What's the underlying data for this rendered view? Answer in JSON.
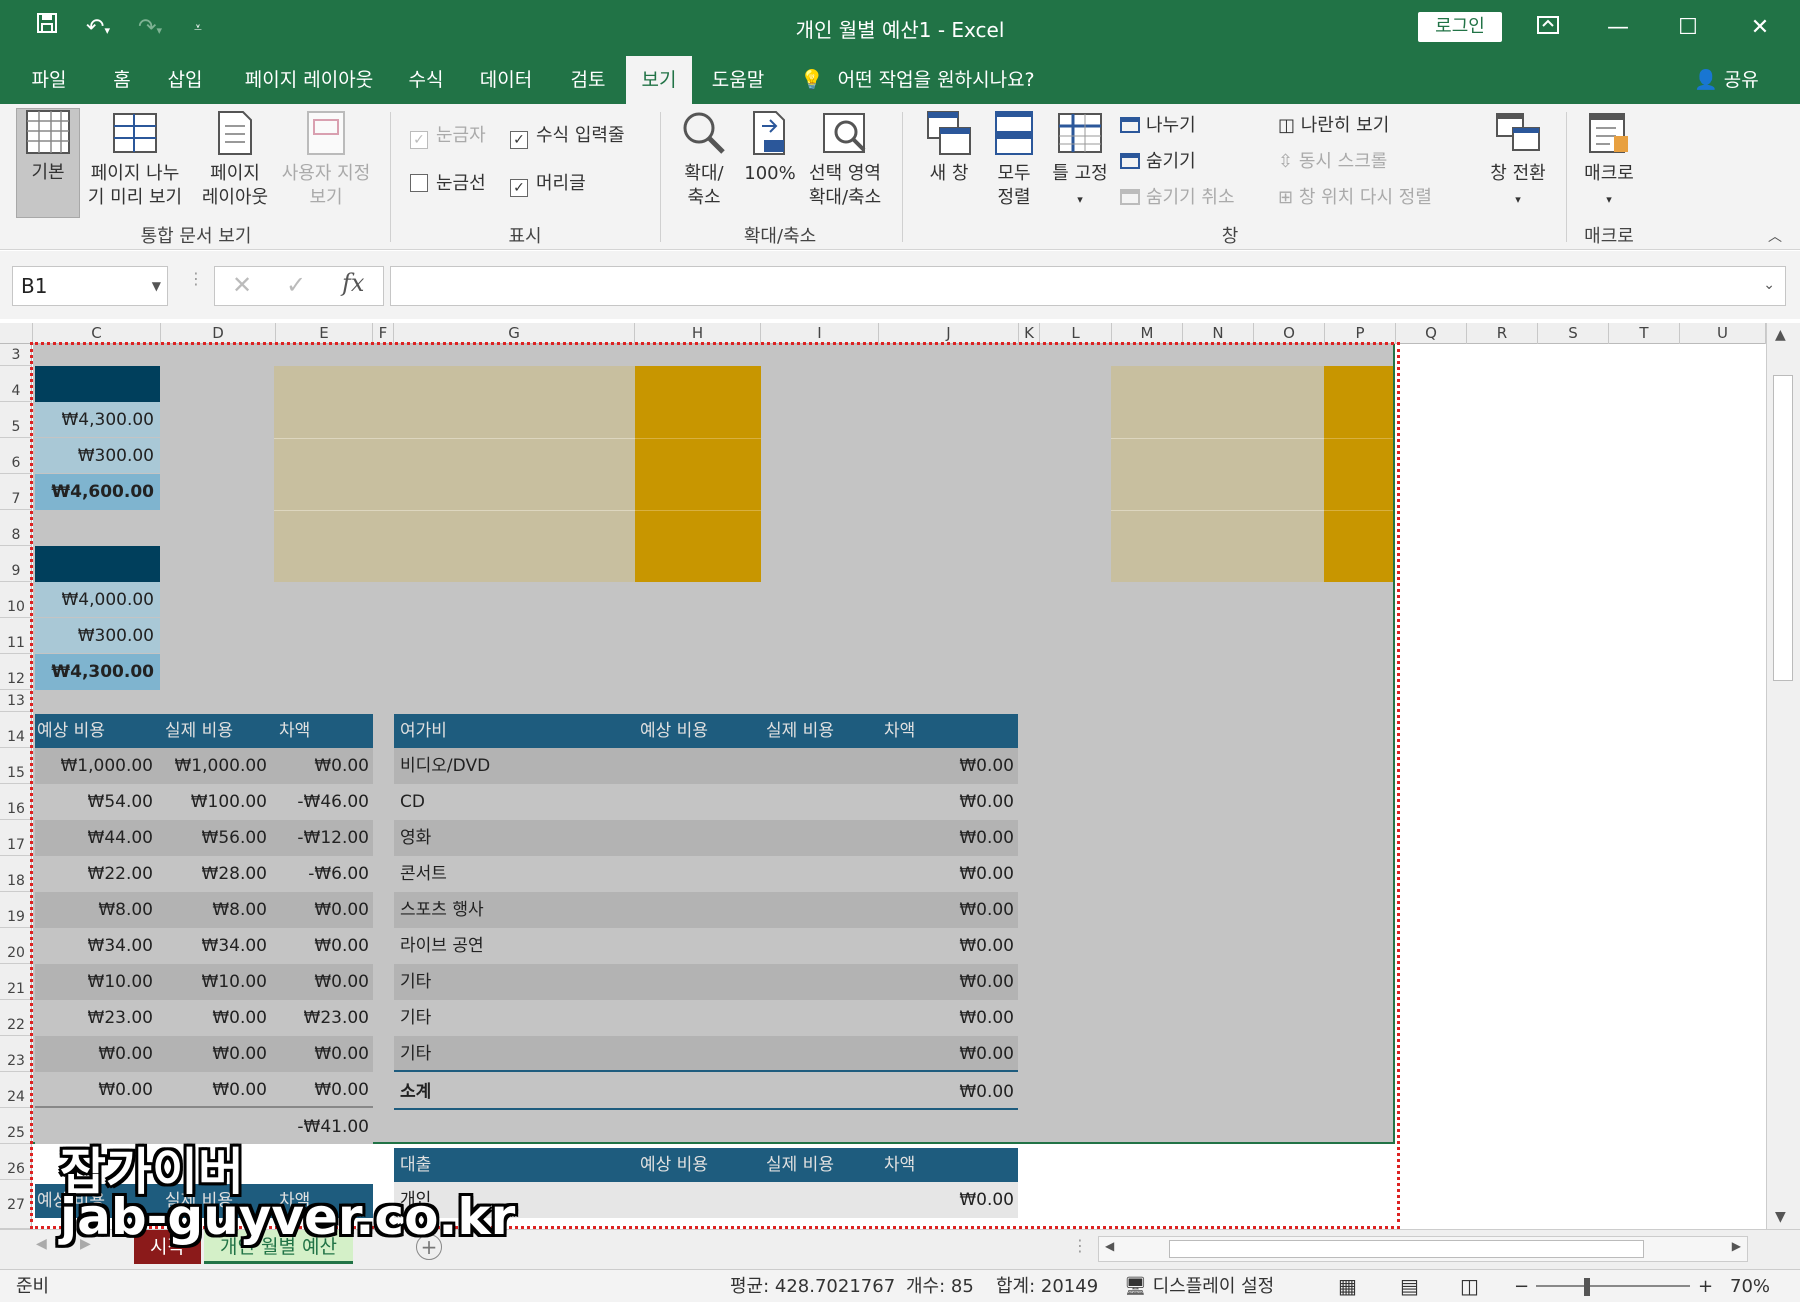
{
  "window": {
    "title": "개인 월별 예산1  -  Excel",
    "login": "로그인"
  },
  "tabs": [
    "파일",
    "홈",
    "삽입",
    "페이지 레이아웃",
    "수식",
    "데이터",
    "검토",
    "보기",
    "도움말"
  ],
  "tell_me": "어떤 작업을 원하시나요?",
  "share": "공유",
  "ribbon": {
    "views": {
      "normal": "기본",
      "page_break_1": "페이지 나누",
      "page_break_2": "기 미리 보기",
      "page_layout_1": "페이지",
      "page_layout_2": "레이아웃",
      "custom_1": "사용자 지정",
      "custom_2": "보기",
      "group": "통합 문서 보기"
    },
    "show": {
      "ruler": "눈금자",
      "formula_bar": "수식 입력줄",
      "gridlines": "눈금선",
      "headings": "머리글",
      "group": "표시"
    },
    "zoom": {
      "zoom_1": "확대/",
      "zoom_2": "축소",
      "hundred": "100%",
      "selection_1": "선택 영역",
      "selection_2": "확대/축소",
      "group": "확대/축소"
    },
    "window": {
      "new": "새 창",
      "arrange_1": "모두",
      "arrange_2": "정렬",
      "freeze": "틀 고정",
      "split": "나누기",
      "hide": "숨기기",
      "unhide": "숨기기 취소",
      "side_by_side": "나란히 보기",
      "sync_scroll": "동시 스크롤",
      "reset_pos": "창 위치 다시 정렬",
      "switch": "창 전환",
      "group": "창"
    },
    "macros": {
      "label": "매크로",
      "group": "매크로"
    }
  },
  "formula": {
    "name_box": "B1",
    "value": ""
  },
  "columns": [
    "C",
    "D",
    "E",
    "F",
    "G",
    "H",
    "I",
    "J",
    "K",
    "L",
    "M",
    "N",
    "O",
    "P",
    "Q",
    "R",
    "S",
    "T",
    "U"
  ],
  "rows": [
    "3",
    "4",
    "5",
    "6",
    "7",
    "8",
    "9",
    "10",
    "11",
    "12",
    "13",
    "14",
    "15",
    "16",
    "17",
    "18",
    "19",
    "20",
    "21",
    "22",
    "23",
    "24",
    "25",
    "26",
    "27"
  ],
  "sheet": {
    "income1": [
      "₩4,300.00",
      "₩300.00",
      "₩4,600.00"
    ],
    "income2": [
      "₩4,000.00",
      "₩300.00",
      "₩4,300.00"
    ],
    "exp_headers": [
      "예상 비용",
      "실제 비용",
      "차액"
    ],
    "exp_rows": [
      [
        "₩1,000.00",
        "₩1,000.00",
        "₩0.00"
      ],
      [
        "₩54.00",
        "₩100.00",
        "-₩46.00"
      ],
      [
        "₩44.00",
        "₩56.00",
        "-₩12.00"
      ],
      [
        "₩22.00",
        "₩28.00",
        "-₩6.00"
      ],
      [
        "₩8.00",
        "₩8.00",
        "₩0.00"
      ],
      [
        "₩34.00",
        "₩34.00",
        "₩0.00"
      ],
      [
        "₩10.00",
        "₩10.00",
        "₩0.00"
      ],
      [
        "₩23.00",
        "₩0.00",
        "₩23.00"
      ],
      [
        "₩0.00",
        "₩0.00",
        "₩0.00"
      ],
      [
        "₩0.00",
        "₩0.00",
        "₩0.00"
      ]
    ],
    "exp_total": "-₩41.00",
    "leisure_headers": [
      "여가비",
      "예상 비용",
      "실제 비용",
      "차액"
    ],
    "leisure_rows": [
      [
        "비디오/DVD",
        "₩0.00"
      ],
      [
        "CD",
        "₩0.00"
      ],
      [
        "영화",
        "₩0.00"
      ],
      [
        "콘서트",
        "₩0.00"
      ],
      [
        "스포츠 행사",
        "₩0.00"
      ],
      [
        "라이브 공연",
        "₩0.00"
      ],
      [
        "기타",
        "₩0.00"
      ],
      [
        "기타",
        "₩0.00"
      ],
      [
        "기타",
        "₩0.00"
      ]
    ],
    "leisure_total": [
      "소계",
      "₩0.00"
    ],
    "loan_headers": [
      "대출",
      "예상 비용",
      "실제 비용",
      "차액"
    ],
    "loan_row": [
      "개인",
      "₩0.00"
    ],
    "bottom_headers": [
      "예상 비용",
      "실제 비용",
      "차액"
    ]
  },
  "sheet_tabs": [
    "시작",
    "개인 월별 예산"
  ],
  "status": {
    "ready": "준비",
    "average": "평균: 428.7021767",
    "count": "개수: 85",
    "sum": "합계: 20149",
    "display": "디스플레이 설정",
    "zoom": "70%"
  },
  "watermark": {
    "line1": "잡가이버",
    "line2": "jab-guyver.co.kr"
  },
  "colors": {
    "excel_green": "#217346",
    "navy": "#003f5c",
    "header_blue": "#1e5c7e",
    "light_blue": "#a9c8d6",
    "mid_blue": "#7fb4cf",
    "tan": "#c8bf9f",
    "gold": "#c89600",
    "row_dark": "#b3b3b3",
    "row_light": "#c4c4c4"
  }
}
